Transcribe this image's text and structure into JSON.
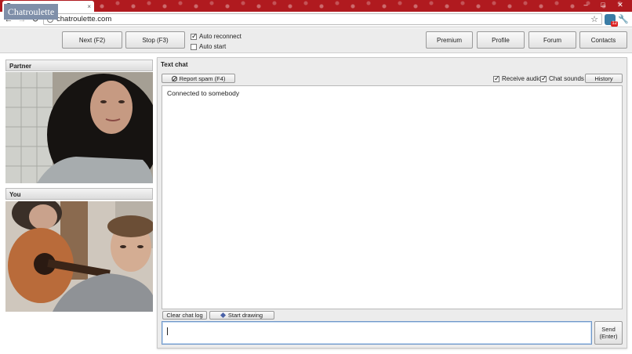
{
  "browser": {
    "tab_title": "Chatroulette",
    "tab_close": "×",
    "window_controls": [
      "–",
      "□",
      "✕"
    ],
    "url": "chatroulette.com",
    "extension_badge": "12"
  },
  "header": {
    "logo": "Chatroulette",
    "next_label": "Next (F2)",
    "stop_label": "Stop (F3)",
    "auto_reconnect_label": "Auto reconnect",
    "auto_reconnect_checked": true,
    "auto_start_label": "Auto start",
    "auto_start_checked": false,
    "nav": {
      "premium": "Premium",
      "profile": "Profile",
      "forum": "Forum",
      "contacts": "Contacts"
    }
  },
  "video": {
    "partner_label": "Partner",
    "you_label": "You"
  },
  "chat": {
    "title": "Text chat",
    "report_label": "Report spam (F4)",
    "receive_audio_label": "Receive audio",
    "receive_audio_checked": true,
    "chat_sounds_label": "Chat sounds",
    "chat_sounds_checked": true,
    "history_label": "History",
    "log_message": "Connected to somebody",
    "clear_label": "Clear chat log",
    "draw_label": "Start drawing",
    "input_value": "",
    "send_line1": "Send",
    "send_line2": "(Enter)"
  },
  "colors": {
    "tabbar": "#b01a1f",
    "logo_bg": "#7f8fa9",
    "input_focus": "#6f96c8"
  }
}
